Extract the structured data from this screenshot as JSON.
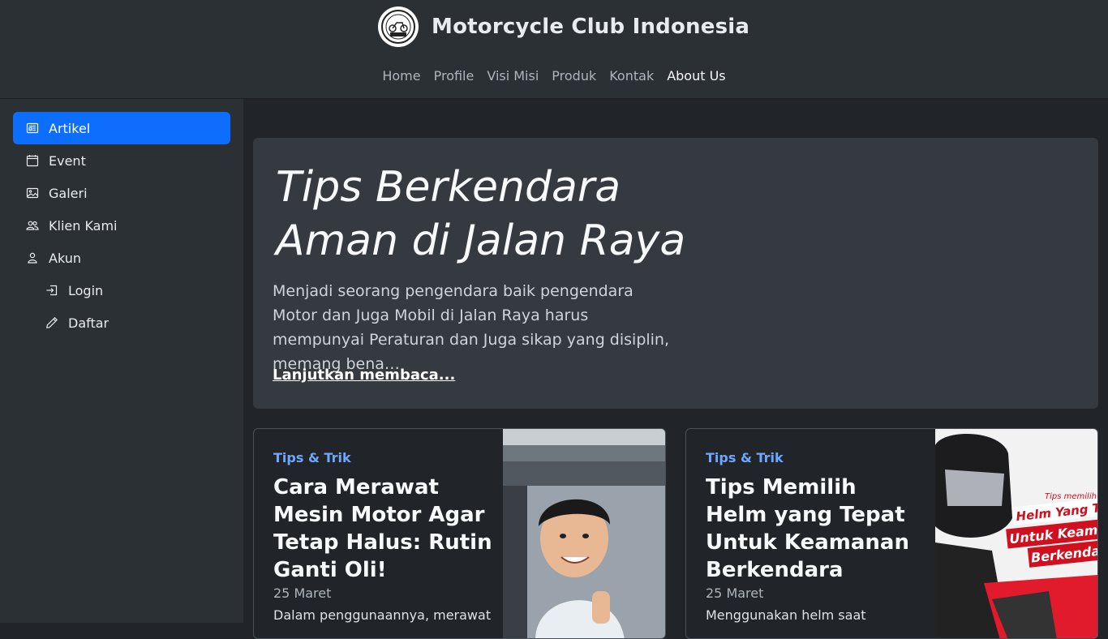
{
  "header": {
    "title": "Motorcycle Club Indonesia",
    "nav": [
      {
        "label": "Home",
        "active": false
      },
      {
        "label": "Profile",
        "active": false
      },
      {
        "label": "Visi Misi",
        "active": false
      },
      {
        "label": "Produk",
        "active": false
      },
      {
        "label": "Kontak",
        "active": false
      },
      {
        "label": "About Us",
        "active": true
      }
    ]
  },
  "sidebar": {
    "items": [
      {
        "label": "Artikel",
        "icon": "newspaper-icon",
        "active": true
      },
      {
        "label": "Event",
        "icon": "calendar-icon",
        "active": false
      },
      {
        "label": "Galeri",
        "icon": "images-icon",
        "active": false
      },
      {
        "label": "Klien Kami",
        "icon": "people-icon",
        "active": false
      },
      {
        "label": "Akun",
        "icon": "person-icon",
        "active": false
      },
      {
        "label": "Login",
        "icon": "login-icon",
        "active": false,
        "sub": true
      },
      {
        "label": "Daftar",
        "icon": "pencil-icon",
        "active": false,
        "sub": true
      }
    ]
  },
  "hero": {
    "title_line1": "Tips Berkendara",
    "title_line2": "Aman di Jalan Raya",
    "text": "Menjadi seorang pengendara baik pengendara Motor dan Juga Mobil di Jalan Raya harus mempunyai Peraturan dan Juga sikap yang disiplin, memang bena…",
    "link": "Lanjutkan membaca..."
  },
  "cards": [
    {
      "category": "Tips & Trik",
      "title": "Cara Merawat Mesin Motor Agar Tetap Halus: Rutin Ganti Oli!",
      "date": "25 Maret",
      "excerpt": "Dalam penggunaannya, merawat"
    },
    {
      "category": "Tips & Trik",
      "title": "Tips Memilih Helm yang Tepat Untuk Keamanan Berkendara",
      "date": "25 Maret",
      "excerpt": "Menggunakan helm saat",
      "image_text": [
        "Tips memilih",
        "Helm Yang T",
        "Untuk Keam",
        "Berkenda"
      ]
    }
  ],
  "colors": {
    "accent": "#0d6efd",
    "category": "#6ea8fe",
    "background": "#212529",
    "panel": "#2b3035"
  }
}
